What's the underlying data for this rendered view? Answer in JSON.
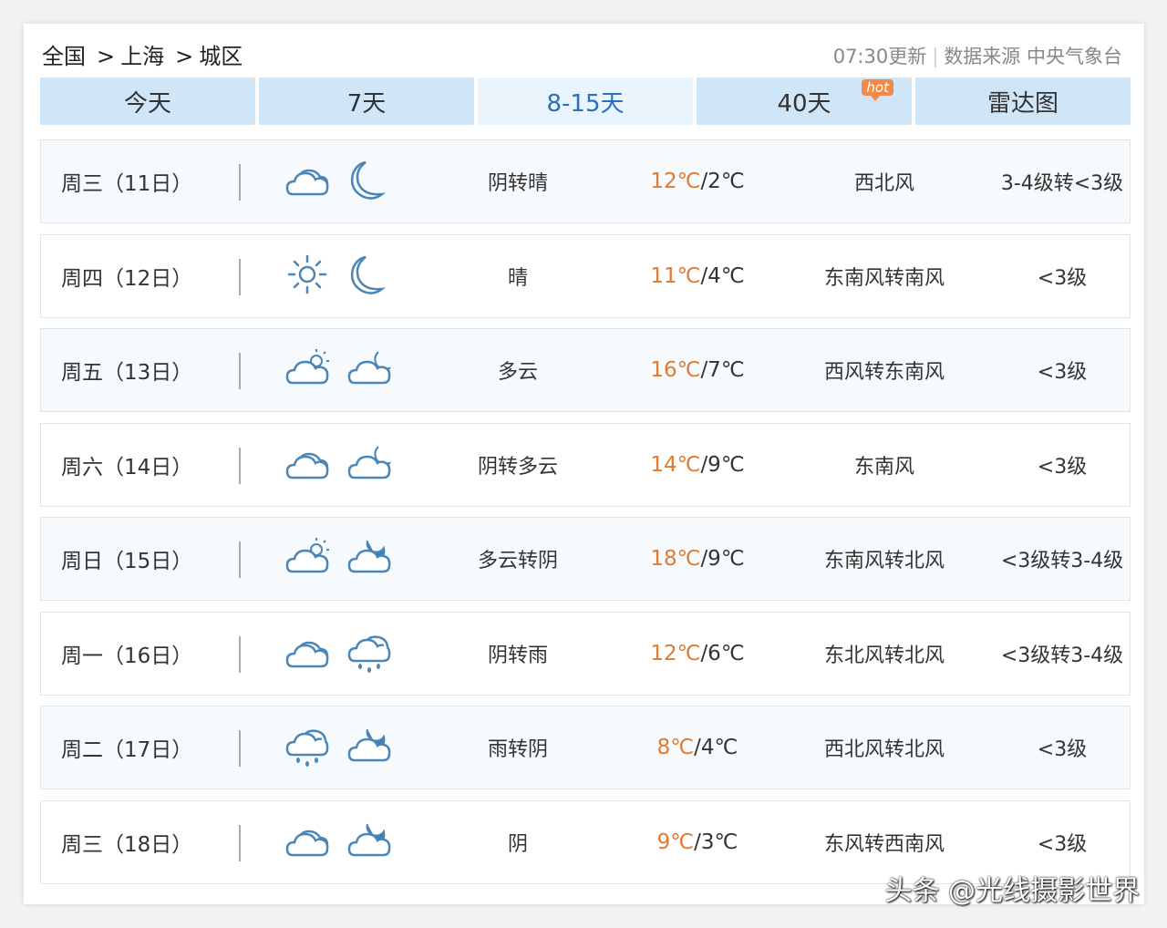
{
  "header": {
    "breadcrumb": [
      "全国",
      "上海",
      "城区"
    ],
    "breadcrumb_sep": ">",
    "update_time": "07:30更新",
    "source": "数据来源 中央气象台"
  },
  "tabs": [
    {
      "label": "今天"
    },
    {
      "label": "7天"
    },
    {
      "label": "8-15天",
      "active": true
    },
    {
      "label": "40天",
      "badge": "hot"
    },
    {
      "label": "雷达图"
    }
  ],
  "forecast": [
    {
      "day": "周三（11日）",
      "icon_day": "cloudy-icon",
      "icon_night": "moon-icon",
      "desc": "阴转晴",
      "high": "12℃",
      "low": "/2℃",
      "wind": "西北风",
      "level": "3-4级转<3级"
    },
    {
      "day": "周四（12日）",
      "icon_day": "sun-icon",
      "icon_night": "moon-icon",
      "desc": "晴",
      "high": "11℃",
      "low": "/4℃",
      "wind": "东南风转南风",
      "level": "<3级"
    },
    {
      "day": "周五（13日）",
      "icon_day": "partly-cloudy-day-icon",
      "icon_night": "partly-cloudy-night-icon",
      "desc": "多云",
      "high": "16℃",
      "low": "/7℃",
      "wind": "西风转东南风",
      "level": "<3级"
    },
    {
      "day": "周六（14日）",
      "icon_day": "cloudy-icon",
      "icon_night": "partly-cloudy-night-icon",
      "desc": "阴转多云",
      "high": "14℃",
      "low": "/9℃",
      "wind": "东南风",
      "level": "<3级"
    },
    {
      "day": "周日（15日）",
      "icon_day": "partly-cloudy-day-icon",
      "icon_night": "cloudy-night-icon",
      "desc": "多云转阴",
      "high": "18℃",
      "low": "/9℃",
      "wind": "东南风转北风",
      "level": "<3级转3-4级"
    },
    {
      "day": "周一（16日）",
      "icon_day": "cloudy-icon",
      "icon_night": "rain-icon",
      "desc": "阴转雨",
      "high": "12℃",
      "low": "/6℃",
      "wind": "东北风转北风",
      "level": "<3级转3-4级"
    },
    {
      "day": "周二（17日）",
      "icon_day": "rain-icon",
      "icon_night": "cloudy-night-icon",
      "desc": "雨转阴",
      "high": "8℃",
      "low": "/4℃",
      "wind": "西北风转北风",
      "level": "<3级"
    },
    {
      "day": "周三（18日）",
      "icon_day": "cloudy-icon",
      "icon_night": "cloudy-night-icon",
      "desc": "阴",
      "high": "9℃",
      "low": "/3℃",
      "wind": "东风转西南风",
      "level": "<3级"
    }
  ],
  "watermark": "头条 @光线摄影世界",
  "colors": {
    "icon": "#4a86b8",
    "high_temp": "#e07a30",
    "tab_bg": "#cfe6f8",
    "tab_active_text": "#2a6fc0"
  }
}
